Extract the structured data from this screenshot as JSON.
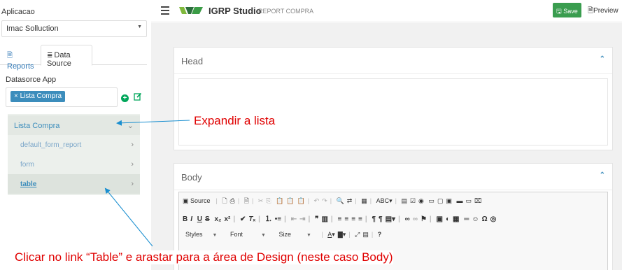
{
  "sidebar": {
    "app_label": "Aplicacao",
    "app_select_value": "Imac Solluction",
    "tabs": [
      {
        "label": "Reports"
      },
      {
        "label": "Data Source"
      }
    ],
    "datasource_label": "Datasorce App",
    "datasource_tag": "Lista Compra",
    "tree": {
      "parent": "Lista Compra",
      "children": [
        {
          "label": "default_form_report"
        },
        {
          "label": "form"
        },
        {
          "label": "table"
        }
      ]
    }
  },
  "topbar": {
    "brand": "IGRP Studio",
    "subtitle": "REPORT COMPRA",
    "save_label": "Save",
    "preview_label": "Preview"
  },
  "main": {
    "head_title": "Head",
    "body_title": "Body",
    "editor": {
      "source_label": "Source",
      "styles_label": "Styles",
      "font_label": "Font",
      "size_label": "Size"
    }
  },
  "annotations": {
    "expand": "Expandir a lista",
    "drag": "Clicar no link “Table” e arastar para a área de Design (neste caso Body)"
  },
  "colors": {
    "accent": "#3c8dbc",
    "save_green": "#3a9d4f",
    "annotation_red": "#e00000"
  }
}
